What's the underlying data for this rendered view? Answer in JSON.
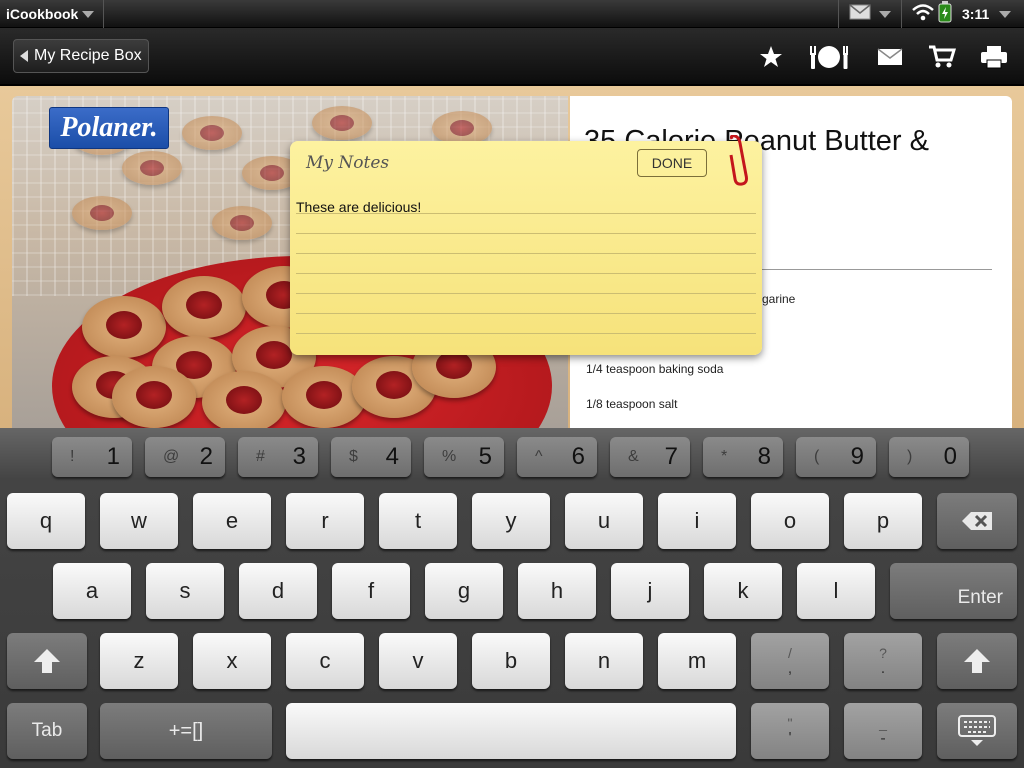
{
  "status_bar": {
    "app_name": "iCookbook",
    "time": "3:11"
  },
  "toolbar": {
    "back_label": "My Recipe Box"
  },
  "recipe": {
    "brand": "Polaner.",
    "title": "35 Calorie Peanut Butter &",
    "ingredients": [
      "garine",
      "1/4 teaspoon baking soda",
      "1/8 teaspoon salt"
    ]
  },
  "notes": {
    "title": "My Notes",
    "done_label": "DONE",
    "text": "These are delicious!"
  },
  "keyboard": {
    "number_row": [
      {
        "sub": "!",
        "main": "1"
      },
      {
        "sub": "@",
        "main": "2"
      },
      {
        "sub": "#",
        "main": "3"
      },
      {
        "sub": "$",
        "main": "4"
      },
      {
        "sub": "%",
        "main": "5"
      },
      {
        "sub": "^",
        "main": "6"
      },
      {
        "sub": "&",
        "main": "7"
      },
      {
        "sub": "*",
        "main": "8"
      },
      {
        "sub": "(",
        "main": "9"
      },
      {
        "sub": ")",
        "main": "0"
      }
    ],
    "row1": [
      "q",
      "w",
      "e",
      "r",
      "t",
      "y",
      "u",
      "i",
      "o",
      "p"
    ],
    "row2": [
      "a",
      "s",
      "d",
      "f",
      "g",
      "h",
      "j",
      "k",
      "l"
    ],
    "row3": [
      "z",
      "x",
      "c",
      "v",
      "b",
      "n",
      "m"
    ],
    "comma_key": {
      "top": "/",
      "bottom": ","
    },
    "period_key": {
      "top": "?",
      "bottom": "."
    },
    "quote_key": {
      "top": "\"",
      "bottom": "'"
    },
    "dash_key": {
      "top": "_",
      "bottom": "-"
    },
    "enter_label": "Enter",
    "tab_label": "Tab",
    "symbols_label": "+=[]"
  }
}
